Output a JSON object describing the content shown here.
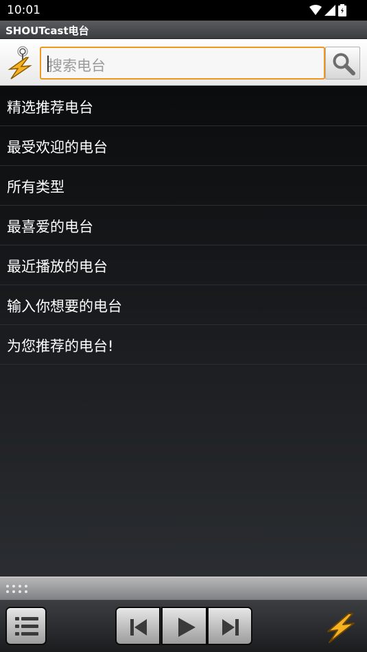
{
  "status": {
    "time": "10:01"
  },
  "app": {
    "title": "SHOUTcast电台"
  },
  "search": {
    "placeholder": "搜索电台"
  },
  "menu": {
    "items": [
      {
        "label": "精选推荐电台"
      },
      {
        "label": "最受欢迎的电台"
      },
      {
        "label": "所有类型"
      },
      {
        "label": "最喜爱的电台"
      },
      {
        "label": "最近播放的电台"
      },
      {
        "label": "输入你想要的电台"
      },
      {
        "label": "为您推荐的电台!"
      }
    ]
  },
  "player": {
    "buttons": [
      "menu-list-icon",
      "skip-previous-icon",
      "play-icon",
      "skip-next-icon",
      "shoutcast-bolt-icon"
    ]
  },
  "colors": {
    "accent": "#f0961e",
    "bolt": "#f5b324",
    "background": "#1a1c1f"
  }
}
